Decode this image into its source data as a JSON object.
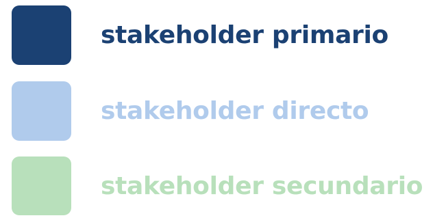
{
  "legend": {
    "items": [
      {
        "label": "stakeholder primario",
        "color": "#1b4173"
      },
      {
        "label": "stakeholder directo",
        "color": "#b0cbec"
      },
      {
        "label": "stakeholder secundario",
        "color": "#b8e0bb"
      }
    ]
  }
}
